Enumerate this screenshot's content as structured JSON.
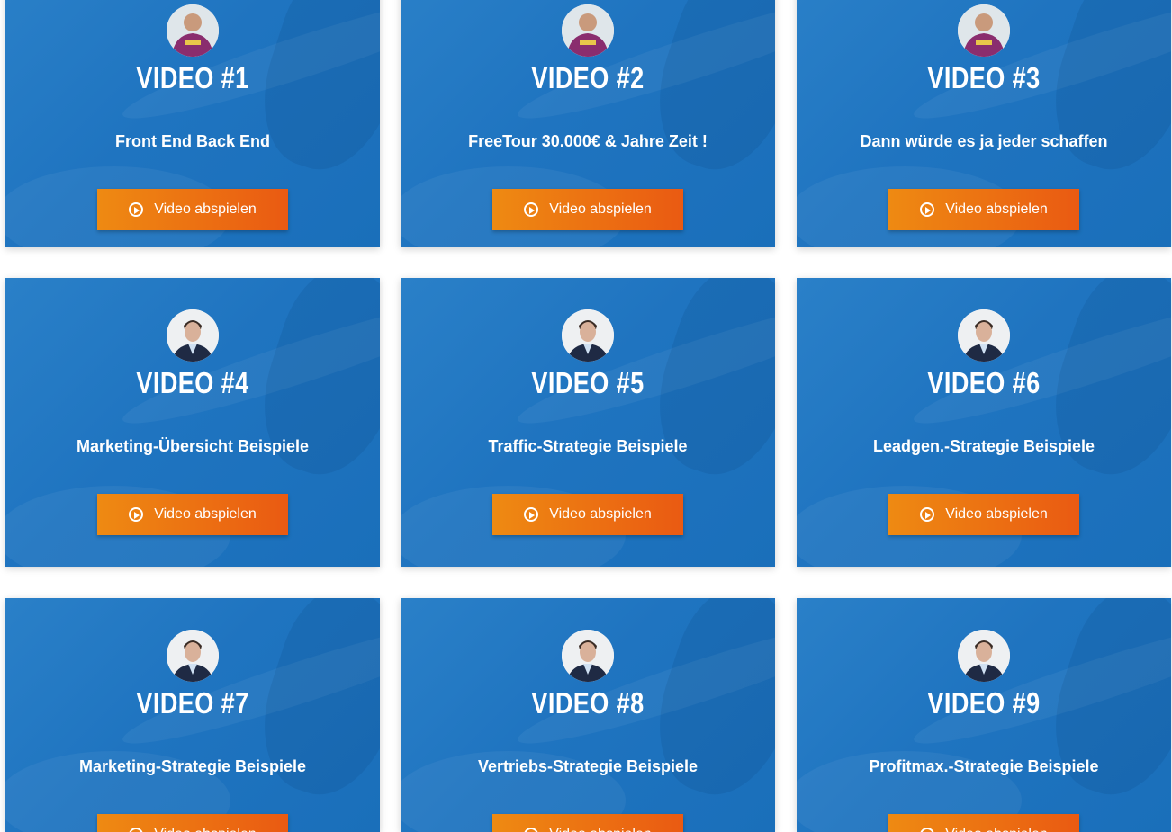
{
  "cards": [
    {
      "title": "VIDEO #1",
      "subtitle": "Front End Back End",
      "button_label": "Video abspielen",
      "avatar": "purple-shirt-person"
    },
    {
      "title": "VIDEO #2",
      "subtitle": "FreeTour 30.000€ & Jahre Zeit !",
      "button_label": "Video abspielen",
      "avatar": "purple-shirt-person"
    },
    {
      "title": "VIDEO #3",
      "subtitle": "Dann würde es ja jeder schaffen",
      "button_label": "Video abspielen",
      "avatar": "purple-shirt-person"
    },
    {
      "title": "VIDEO #4",
      "subtitle": "Marketing-Übersicht Beispiele",
      "button_label": "Video abspielen",
      "avatar": "suit-man"
    },
    {
      "title": "VIDEO #5",
      "subtitle": "Traffic-Strategie Beispiele",
      "button_label": "Video abspielen",
      "avatar": "suit-man"
    },
    {
      "title": "VIDEO #6",
      "subtitle": "Leadgen.-Strategie Beispiele",
      "button_label": "Video abspielen",
      "avatar": "suit-man"
    },
    {
      "title": "VIDEO #7",
      "subtitle": "Marketing-Strategie Beispiele",
      "button_label": "Video abspielen",
      "avatar": "suit-man"
    },
    {
      "title": "VIDEO #8",
      "subtitle": "Vertriebs-Strategie Beispiele",
      "button_label": "Video abspielen",
      "avatar": "suit-man"
    },
    {
      "title": "VIDEO #9",
      "subtitle": "Profitmax.-Strategie Beispiele",
      "button_label": "Video abspielen",
      "avatar": "suit-man"
    }
  ],
  "colors": {
    "card_blue": "#1f74c0",
    "button_start": "#ee8a12",
    "button_end": "#ea5a12",
    "text": "#ffffff"
  },
  "icons": {
    "button": "play-circle-icon"
  }
}
